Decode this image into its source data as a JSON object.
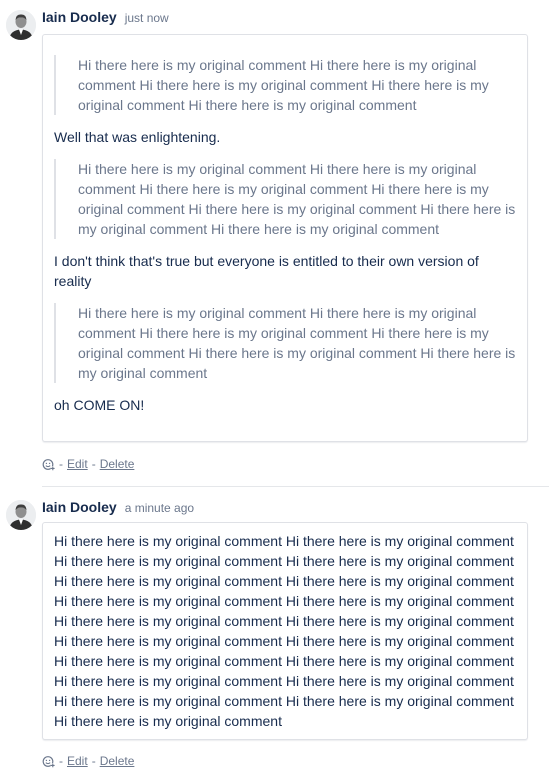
{
  "comments": [
    {
      "author": "Iain Dooley",
      "time": "just now",
      "blocks": [
        {
          "type": "quote",
          "text": "Hi there here is my original comment Hi there here is my original comment Hi there here is my original comment Hi there here is my original comment Hi there here is my original comment"
        },
        {
          "type": "para",
          "text": "Well that was enlightening."
        },
        {
          "type": "quote",
          "text": "Hi there here is my original comment Hi there here is my original comment Hi there here is my original comment Hi there here is my original comment Hi there here is my original comment Hi there here is my original comment Hi there here is my original comment"
        },
        {
          "type": "para",
          "text": "I don't think that's true but everyone is entitled to their own version of reality"
        },
        {
          "type": "quote",
          "text": "Hi there here is my original comment Hi there here is my original comment Hi there here is my original comment Hi there here is my original comment Hi there here is my original comment Hi there here is my original comment"
        },
        {
          "type": "para",
          "text": "oh COME ON!"
        }
      ],
      "actions": {
        "sep": "-",
        "edit": "Edit",
        "delete": "Delete",
        "react_icon": "add-reaction-icon"
      }
    },
    {
      "author": "Iain Dooley",
      "time": "a minute ago",
      "text": "Hi there here is my original comment Hi there here is my original comment Hi there here is my original comment Hi there here is my original comment Hi there here is my original comment Hi there here is my original comment Hi there here is my original comment Hi there here is my original comment Hi there here is my original comment Hi there here is my original comment Hi there here is my original comment Hi there here is my original comment Hi there here is my original comment Hi there here is my original comment Hi there here is my original comment Hi there here is my original comment Hi there here is my original comment Hi there here is my original comment Hi there here is my original comment",
      "actions": {
        "sep": "-",
        "edit": "Edit",
        "delete": "Delete",
        "react_icon": "add-reaction-icon"
      }
    }
  ],
  "colors": {
    "text": "#172b4d",
    "muted": "#6b778c",
    "border": "#dfe1e6"
  }
}
